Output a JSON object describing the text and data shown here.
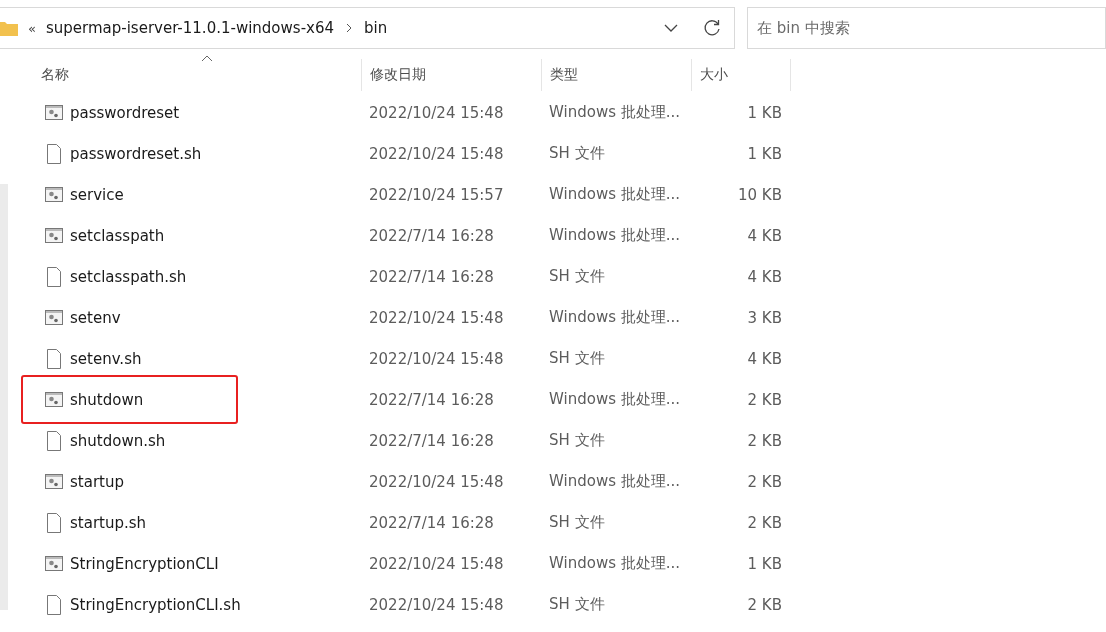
{
  "address_bar": {
    "overflow": "«",
    "path": [
      {
        "label": "supermap-iserver-11.0.1-windows-x64"
      },
      {
        "label": "bin"
      }
    ]
  },
  "search": {
    "placeholder": "在 bin 中搜索"
  },
  "table": {
    "columns": [
      "名称",
      "修改日期",
      "类型",
      "大小"
    ],
    "rows": [
      {
        "kind": "batch",
        "name": "passwordreset",
        "date": "2022/10/24 15:48",
        "type": "Windows 批处理...",
        "size": "1 KB",
        "highlighted": false
      },
      {
        "kind": "file",
        "name": "passwordreset.sh",
        "date": "2022/10/24 15:48",
        "type": "SH 文件",
        "size": "1 KB",
        "highlighted": false
      },
      {
        "kind": "batch",
        "name": "service",
        "date": "2022/10/24 15:57",
        "type": "Windows 批处理...",
        "size": "10 KB",
        "highlighted": false
      },
      {
        "kind": "batch",
        "name": "setclasspath",
        "date": "2022/7/14 16:28",
        "type": "Windows 批处理...",
        "size": "4 KB",
        "highlighted": false
      },
      {
        "kind": "file",
        "name": "setclasspath.sh",
        "date": "2022/7/14 16:28",
        "type": "SH 文件",
        "size": "4 KB",
        "highlighted": false
      },
      {
        "kind": "batch",
        "name": "setenv",
        "date": "2022/10/24 15:48",
        "type": "Windows 批处理...",
        "size": "3 KB",
        "highlighted": false
      },
      {
        "kind": "file",
        "name": "setenv.sh",
        "date": "2022/10/24 15:48",
        "type": "SH 文件",
        "size": "4 KB",
        "highlighted": false
      },
      {
        "kind": "batch",
        "name": "shutdown",
        "date": "2022/7/14 16:28",
        "type": "Windows 批处理...",
        "size": "2 KB",
        "highlighted": true
      },
      {
        "kind": "file",
        "name": "shutdown.sh",
        "date": "2022/7/14 16:28",
        "type": "SH 文件",
        "size": "2 KB",
        "highlighted": false
      },
      {
        "kind": "batch",
        "name": "startup",
        "date": "2022/10/24 15:48",
        "type": "Windows 批处理...",
        "size": "2 KB",
        "highlighted": false
      },
      {
        "kind": "file",
        "name": "startup.sh",
        "date": "2022/7/14 16:28",
        "type": "SH 文件",
        "size": "2 KB",
        "highlighted": false
      },
      {
        "kind": "batch",
        "name": "StringEncryptionCLI",
        "date": "2022/10/24 15:48",
        "type": "Windows 批处理...",
        "size": "1 KB",
        "highlighted": false
      },
      {
        "kind": "file",
        "name": "StringEncryptionCLI.sh",
        "date": "2022/10/24 15:48",
        "type": "SH 文件",
        "size": "2 KB",
        "highlighted": false
      }
    ]
  }
}
